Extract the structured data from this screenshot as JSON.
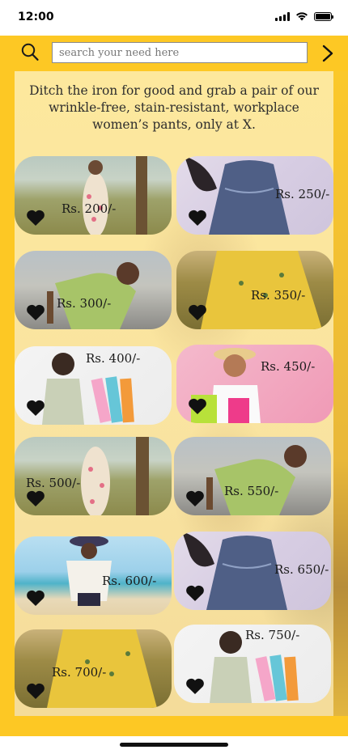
{
  "status_bar": {
    "time": "12:00"
  },
  "search": {
    "placeholder": "search your need here"
  },
  "banner": {
    "headline": "Ditch the iron for good and grab a pair of our wrinkle-free, stain-resistant, workplace women’s pants, only at X."
  },
  "products": [
    {
      "price": "Rs. 200/-",
      "scene": "outdoor dress"
    },
    {
      "price": "Rs. 250/-",
      "scene": "blue dress"
    },
    {
      "price": "Rs. 300/-",
      "scene": "green dress"
    },
    {
      "price": "Rs. 350/-",
      "scene": "yellow dress"
    },
    {
      "price": "Rs. 400/-",
      "scene": "shopping bags"
    },
    {
      "price": "Rs. 450/-",
      "scene": "pink background"
    },
    {
      "price": "Rs. 500/-",
      "scene": "outdoor dress"
    },
    {
      "price": "Rs. 550/-",
      "scene": "green dress"
    },
    {
      "price": "Rs. 600/-",
      "scene": "beach"
    },
    {
      "price": "Rs. 650/-",
      "scene": "blue dress"
    },
    {
      "price": "Rs. 700/-",
      "scene": "yellow dress"
    },
    {
      "price": "Rs. 750/-",
      "scene": "shopping bags"
    }
  ],
  "icons": {
    "search": "search-icon",
    "next": "chevron-right-icon",
    "favorite": "heart-icon"
  },
  "colors": {
    "accent": "#fdc824",
    "panel": "#fce8a0",
    "heart": "#111111"
  }
}
